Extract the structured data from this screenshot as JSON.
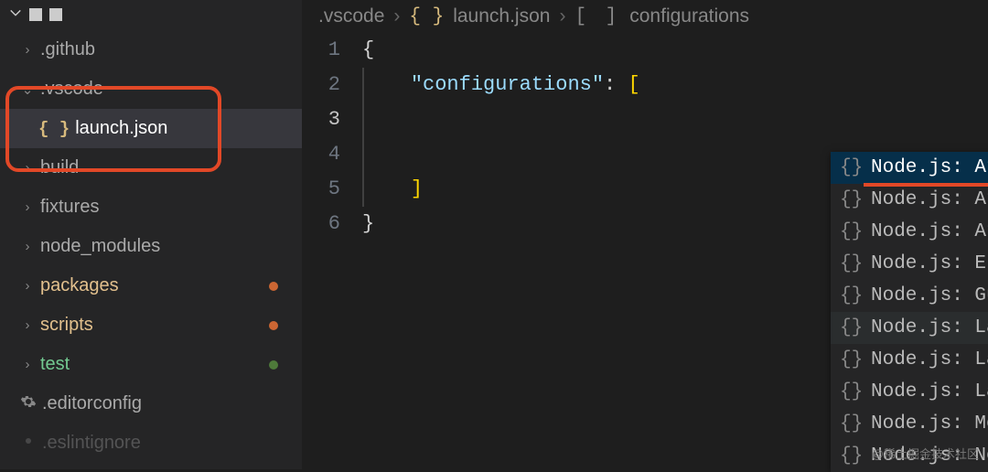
{
  "sidebar": {
    "items": [
      {
        "label": ".github",
        "kind": "folder",
        "expanded": false
      },
      {
        "label": ".vscode",
        "kind": "folder",
        "expanded": true
      },
      {
        "label": "launch.json",
        "kind": "json",
        "selected": true
      },
      {
        "label": "build",
        "kind": "folder",
        "expanded": false
      },
      {
        "label": "fixtures",
        "kind": "folder",
        "expanded": false
      },
      {
        "label": "node_modules",
        "kind": "folder",
        "expanded": false
      },
      {
        "label": "packages",
        "kind": "folder",
        "expanded": false,
        "status": "modified",
        "dot": "orange"
      },
      {
        "label": "scripts",
        "kind": "folder",
        "expanded": false,
        "status": "modified",
        "dot": "orange"
      },
      {
        "label": "test",
        "kind": "folder",
        "expanded": false,
        "status": "untracked",
        "dot": "green"
      },
      {
        "label": ".editorconfig",
        "kind": "gear"
      },
      {
        "label": ".eslintignore",
        "kind": "gear"
      }
    ]
  },
  "breadcrumb": {
    "seg1": ".vscode",
    "seg2": "launch.json",
    "seg3": "configurations"
  },
  "editor": {
    "line_numbers": [
      "1",
      "2",
      "3",
      "4",
      "5",
      "6"
    ],
    "code": {
      "l1": "{",
      "l2_key": "\"configurations\"",
      "l2_colon": ": ",
      "l2_open": "[",
      "l3": "",
      "l4": "",
      "l5_close": "]",
      "l6": "}"
    }
  },
  "autocomplete": [
    "Node.js: Attach",
    "Node.js: Attach to Process",
    "Node.js: Attach to Remote Progra",
    "Node.js: Electron Main",
    "Node.js: Gulp task",
    "Node.js: Launch Program",
    "Node.js: Launch via NPM",
    "Node.js: Launch via npm",
    "Node.js: Mocha Tests",
    "Node.js: Nodemon Setup"
  ],
  "watermark": "@稀土掘金技术社区"
}
